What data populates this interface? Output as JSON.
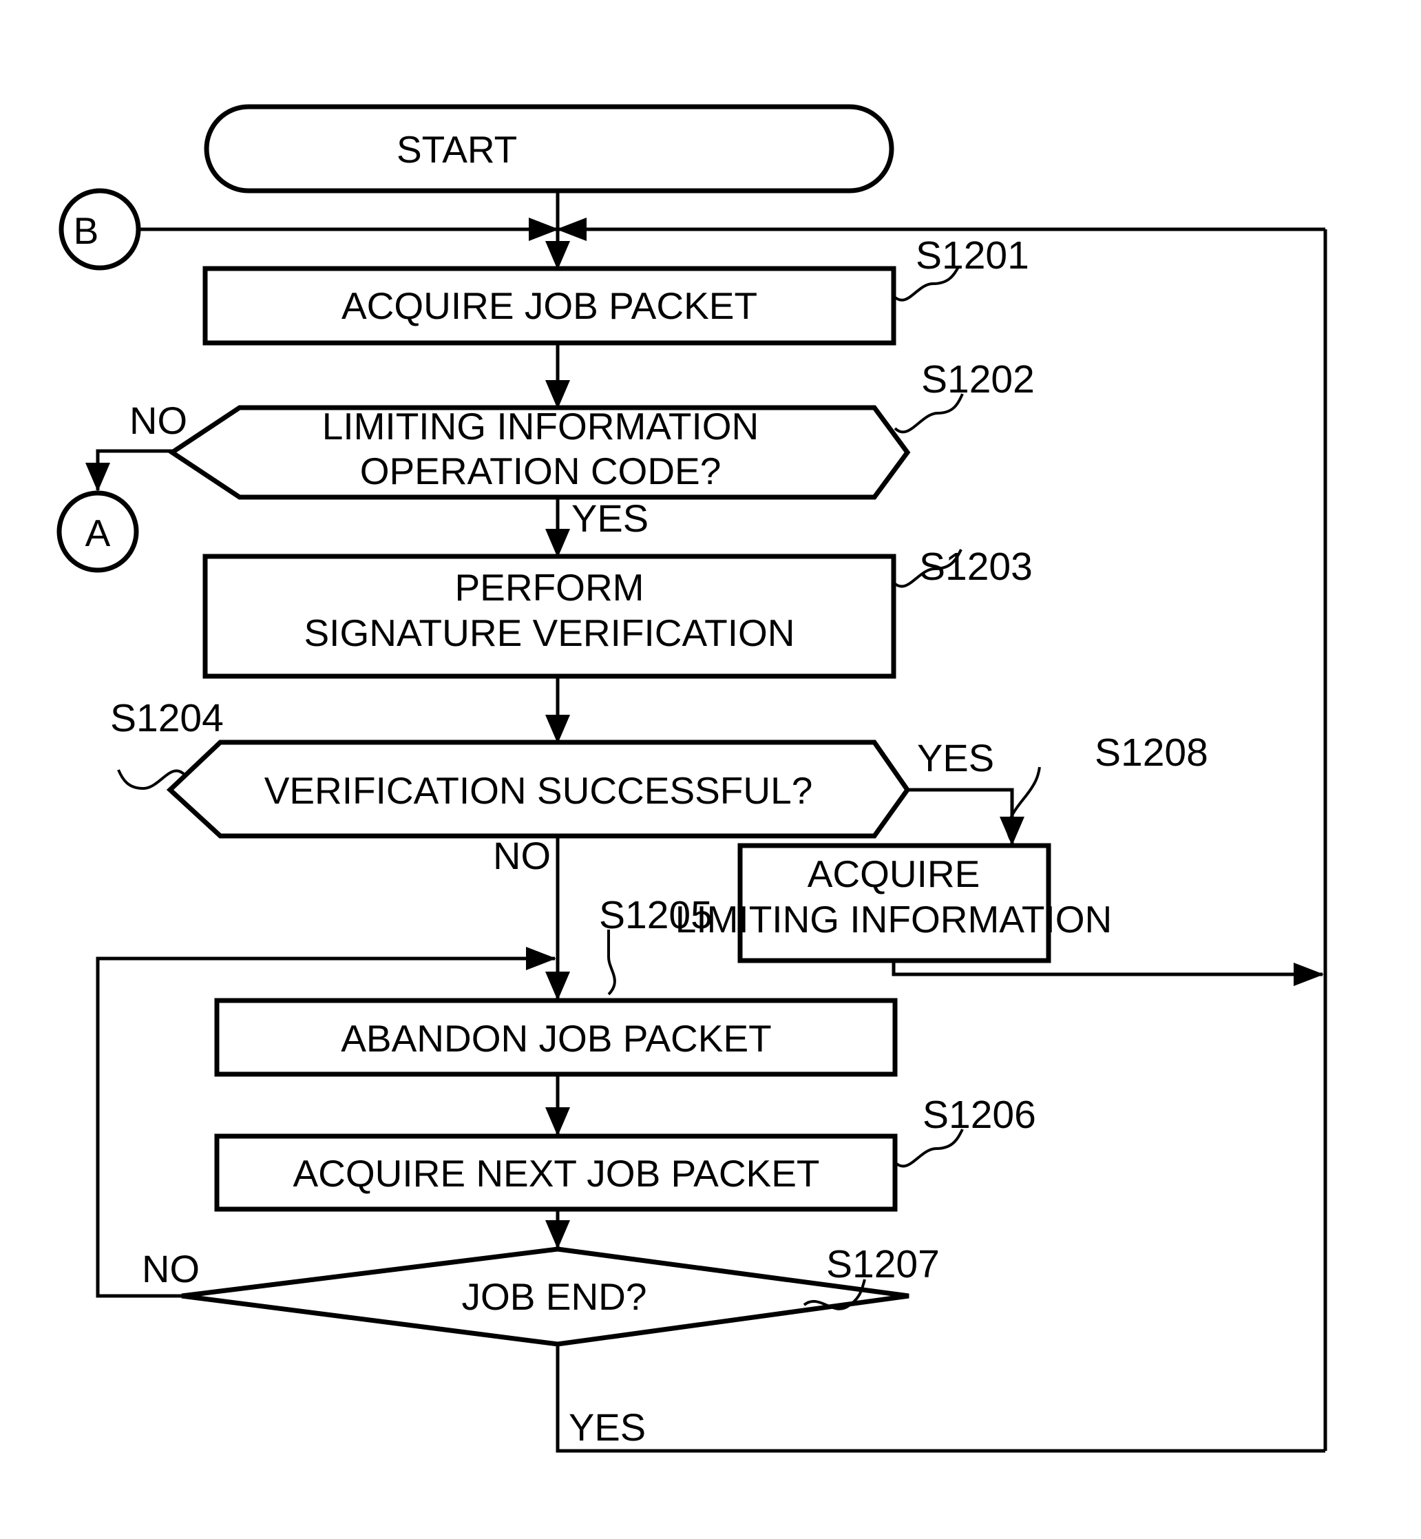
{
  "figure": {
    "type": "flowchart",
    "title": "",
    "orientation": "vertical"
  },
  "nodes": {
    "start": {
      "id": "start",
      "shape": "terminator",
      "label": "START"
    },
    "connector_b": {
      "id": "connector_b",
      "shape": "circle-connector",
      "label": "B"
    },
    "connector_a": {
      "id": "connector_a",
      "shape": "circle-connector",
      "label": "A"
    },
    "s1201": {
      "id": "S1201",
      "shape": "process",
      "label": "ACQUIRE JOB PACKET"
    },
    "s1202": {
      "id": "S1202",
      "shape": "decision-hexagon",
      "line1": "LIMITING INFORMATION",
      "line2": "OPERATION CODE?"
    },
    "s1203": {
      "id": "S1203",
      "shape": "process",
      "line1": "PERFORM",
      "line2": "SIGNATURE VERIFICATION"
    },
    "s1204": {
      "id": "S1204",
      "shape": "decision-hexagon",
      "label": "VERIFICATION SUCCESSFUL?"
    },
    "s1205": {
      "id": "S1205",
      "shape": "process",
      "label": "ABANDON JOB PACKET"
    },
    "s1206": {
      "id": "S1206",
      "shape": "process",
      "label": "ACQUIRE NEXT JOB PACKET"
    },
    "s1207": {
      "id": "S1207",
      "shape": "decision-diamond",
      "label": "JOB END?"
    },
    "s1208": {
      "id": "S1208",
      "shape": "process",
      "line1": "ACQUIRE",
      "line2": "LIMITING INFORMATION"
    }
  },
  "step_tags": {
    "s1201": "S1201",
    "s1202": "S1202",
    "s1203": "S1203",
    "s1204": "S1204",
    "s1205": "S1205",
    "s1206": "S1206",
    "s1207": "S1207",
    "s1208": "S1208"
  },
  "edge_labels": {
    "s1202_no": "NO",
    "s1202_yes": "YES",
    "s1204_yes": "YES",
    "s1204_no": "NO",
    "s1207_no": "NO",
    "s1207_yes": "YES"
  },
  "colors": {
    "stroke": "#000000",
    "fill": "#ffffff",
    "background": "#ffffff"
  }
}
